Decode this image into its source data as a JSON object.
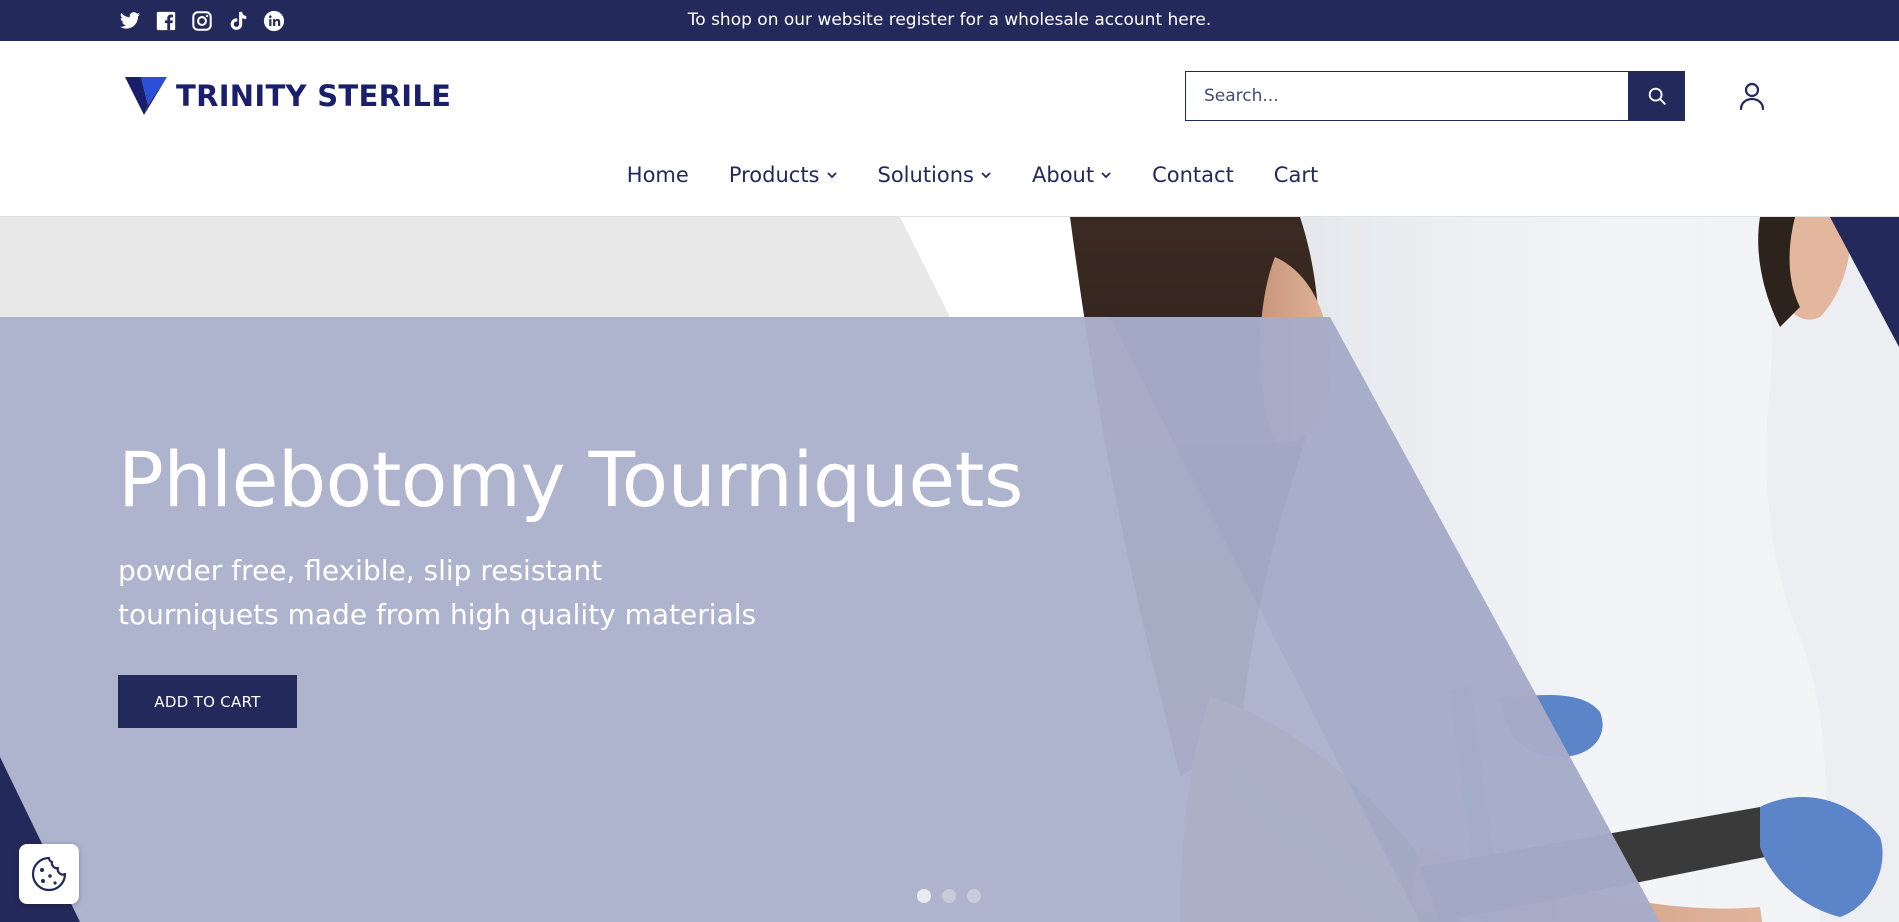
{
  "announcement": {
    "text": "To shop on our website register for a wholesale account here."
  },
  "social": [
    {
      "icon": "twitter-icon"
    },
    {
      "icon": "facebook-icon"
    },
    {
      "icon": "instagram-icon"
    },
    {
      "icon": "tiktok-icon"
    },
    {
      "icon": "linkedin-icon"
    }
  ],
  "logo": {
    "text": "TRINITY STERILE"
  },
  "search": {
    "placeholder": "Search..."
  },
  "nav": {
    "items": [
      {
        "label": "Home",
        "dropdown": false
      },
      {
        "label": "Products",
        "dropdown": true
      },
      {
        "label": "Solutions",
        "dropdown": true
      },
      {
        "label": "About",
        "dropdown": true
      },
      {
        "label": "Contact",
        "dropdown": false
      },
      {
        "label": "Cart",
        "dropdown": false
      }
    ]
  },
  "hero": {
    "title": "Phlebotomy Tourniquets",
    "subtitle_line1": "powder free, flexible, slip resistant",
    "subtitle_line2": "tourniquets made from high quality materials",
    "cta_label": "ADD TO CART",
    "slides_total": 3,
    "active_slide": 1
  },
  "colors": {
    "brand_navy": "#24295b",
    "logo_blue": "#1a1f6b",
    "hero_overlay": "#adb2cd",
    "hero_gray": "#e8e8e8"
  }
}
